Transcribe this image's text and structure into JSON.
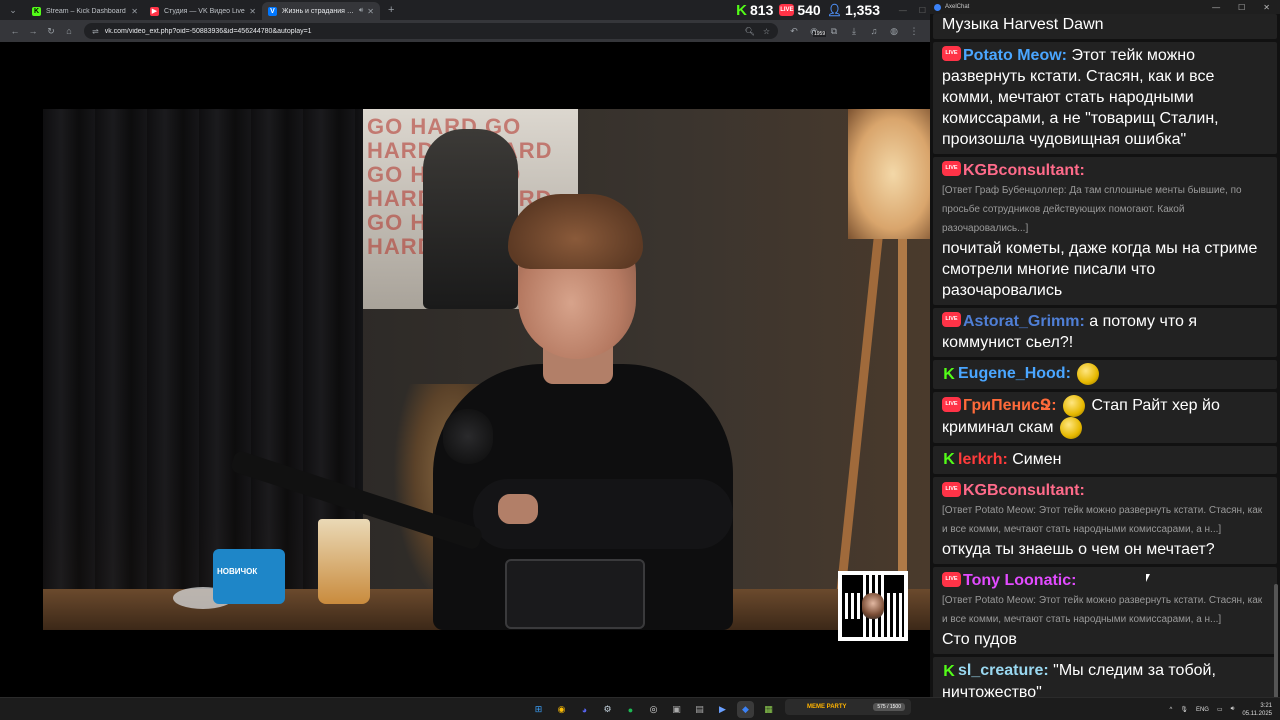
{
  "browser": {
    "tabs": [
      {
        "title": "Stream – Kick Dashboard",
        "favicon": "kick-icon",
        "color": "#53fc18",
        "glyph": "K",
        "active": false
      },
      {
        "title": "Студия — VK Видео Live",
        "favicon": "vk-live-icon",
        "color": "#ff3347",
        "glyph": "▶",
        "active": false
      },
      {
        "title": "Жизнь и страдания Роман",
        "favicon": "vk-icon",
        "color": "#0077ff",
        "glyph": "V",
        "active": true
      }
    ],
    "url": "vk.com/video_ext.php?oid=-50883936&id=456244780&autoplay=1",
    "extension_badge": "1959"
  },
  "counters": {
    "kick": "813",
    "vk_live": "540",
    "viewers": "1,353"
  },
  "video": {
    "mug_text": "НОВИЧОК",
    "poster_text": "GO HARD GO HARD GO HARD GO HARD GO HARD GO HARD GO HARD GO HARD"
  },
  "chat": {
    "app_title": "AxelChat",
    "header_text": "Музыка Harvest Dawn",
    "messages": [
      {
        "platform": "live",
        "user": "Potato Meow:",
        "user_color": "#4aa6ff",
        "text": "Этот тейк можно развернуть кстати. Стасян, как и все комми, мечтают стать народными комиссарами, а не \"товарищ Сталин, произошла чудовищная ошибка\""
      },
      {
        "platform": "live",
        "user": "KGBconsultant:",
        "user_color": "#ff6b8a",
        "reply": "[Ответ Граф Бубенцоллер: Да там сплошные менты бывшие, по просьбе сотрудников действующих помогают. Какой разочаровались...]",
        "text": "почитай кометы, даже когда мы на стриме смотрели многие писали что разочаровались"
      },
      {
        "platform": "live",
        "user": "Astorat_Grimm:",
        "user_color": "#4f7fd6",
        "text": "а потому что я коммунист сьел?!"
      },
      {
        "platform": "kick",
        "user": "Eugene_Hood:",
        "user_color": "#4aa6ff",
        "emote": "peepo-emote",
        "text": ""
      },
      {
        "platform": "live",
        "user": "ГриПенисՋ:",
        "user_color": "#ff6a3a",
        "text_pre_emote": "peepo-emote",
        "text": "Стап Райт хер йо криминал скам",
        "emote_end": "peepo-emote"
      },
      {
        "platform": "kick",
        "user": "lerkrh:",
        "user_color": "#ff3b3b",
        "text": "Симен"
      },
      {
        "platform": "live",
        "user": "KGBconsultant:",
        "user_color": "#ff6b8a",
        "reply": "[Ответ Potato Meow: Этот тейк можно развернуть кстати. Стасян, как и все комми, мечтают стать народными комиссарами, а н...]",
        "text": "откуда ты знаешь о чем он мечтает?"
      },
      {
        "platform": "live",
        "user": "Tony Loonatic:",
        "user_color": "#e24bff",
        "reply": "[Ответ Potato Meow: Этот тейк можно развернуть кстати. Стасян, как и все комми, мечтают стать народными комиссарами, а н...]",
        "text": "Сто пудов"
      },
      {
        "platform": "kick",
        "user": "sl_creature:",
        "user_color": "#9ad8f0",
        "text": "\"Мы следим за тобой, ничтожество\""
      }
    ]
  },
  "taskbar": {
    "meme_party_label": "MEME PARTY",
    "meme_count": "575 / 1500",
    "language": "ENG",
    "time": "3:21",
    "date": "05.11.2025"
  }
}
